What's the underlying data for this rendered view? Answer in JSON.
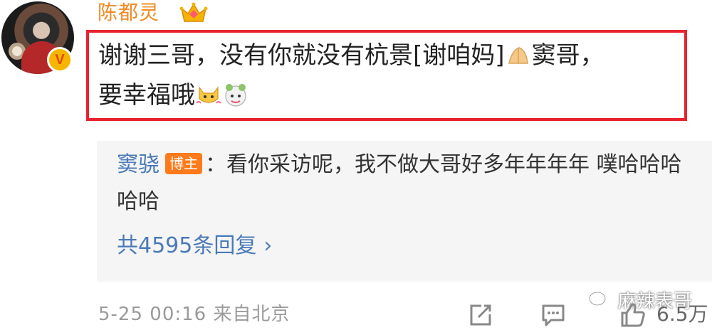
{
  "comment": {
    "username": "陈都灵",
    "verified_badge": "V",
    "text_part1": "谢谢三哥，没有你就没有杭景[谢咱妈]",
    "text_part2": "窦哥，",
    "text_part3": "要幸福哦",
    "icons": [
      "crown-icon",
      "pray-hands-emoji",
      "cat-emoji",
      "cartoon-emoji"
    ],
    "highlight_color": "#e8232f",
    "username_color": "#f08a24"
  },
  "reply": {
    "author": "窦骁",
    "author_tag": "博主",
    "text": "：看你采访呢，我不做大哥好多年年年年 噗哈哈哈哈哈",
    "count_label": "共4595条回复",
    "chevron": "›",
    "link_color": "#4a7ab8"
  },
  "meta": {
    "timestamp": "5-25 00:16",
    "source": "来自北京",
    "likes": "6.5万",
    "action_icons": [
      "share-icon",
      "comment-icon",
      "like-icon"
    ]
  },
  "watermark": {
    "text": "麻辣表哥"
  }
}
